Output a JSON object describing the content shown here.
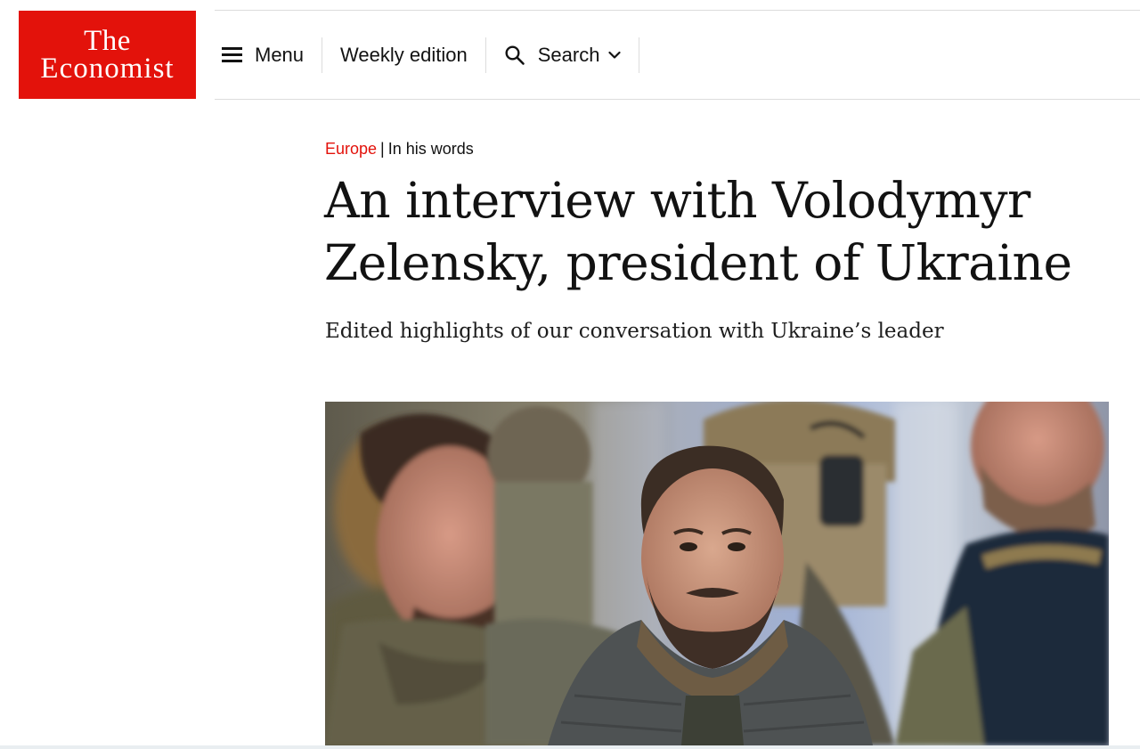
{
  "brand": {
    "logo_line1": "The",
    "logo_line2": "Economist",
    "color": "#e3120b"
  },
  "nav": {
    "menu_label": "Menu",
    "menu_icon": "hamburger-icon",
    "weekly_label": "Weekly edition",
    "search_label": "Search",
    "search_icon": "search-icon",
    "search_chevron_icon": "chevron-down-icon"
  },
  "article": {
    "section": "Europe",
    "separator": "|",
    "subsection": "In his words",
    "headline": "An interview with Volodymyr Zelensky, president of Ukraine",
    "standfirst": "Edited highlights of our conversation with Ukraine’s leader"
  },
  "hero_image": {
    "subject": "photo"
  }
}
